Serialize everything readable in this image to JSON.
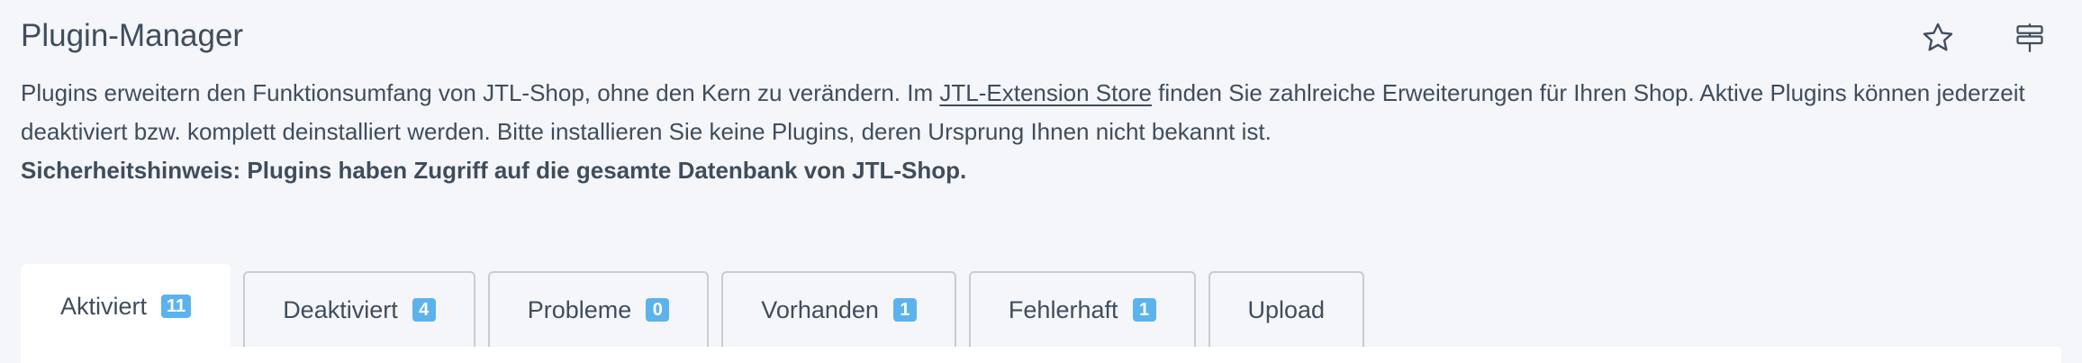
{
  "header": {
    "title": "Plugin-Manager",
    "favorite_icon": "star-icon",
    "settings_icon": "signpost-icon"
  },
  "description": {
    "text_part1": "Plugins erweitern den Funktionsumfang von JTL-Shop, ohne den Kern zu verändern. Im ",
    "link_text": "JTL-Extension Store",
    "text_part2": " finden Sie zahlreiche Erweiterungen für Ihren Shop. Aktive Plugins können jederzeit deaktiviert bzw. komplett deinstalliert werden. Bitte installieren Sie keine Plugins, deren Ursprung Ihnen nicht bekannt ist.",
    "security_note": "Sicherheitshinweis: Plugins haben Zugriff auf die gesamte Datenbank von JTL-Shop."
  },
  "tabs": [
    {
      "label": "Aktiviert",
      "count": "11",
      "active": true
    },
    {
      "label": "Deaktiviert",
      "count": "4",
      "active": false
    },
    {
      "label": "Probleme",
      "count": "0",
      "active": false
    },
    {
      "label": "Vorhanden",
      "count": "1",
      "active": false
    },
    {
      "label": "Fehlerhaft",
      "count": "1",
      "active": false
    },
    {
      "label": "Upload",
      "count": null,
      "active": false
    }
  ],
  "colors": {
    "background": "#f5f6fa",
    "text": "#3f4d5c",
    "badge": "#5cb3ec",
    "tab_border": "#c8ccd3",
    "active_tab": "#ffffff"
  }
}
